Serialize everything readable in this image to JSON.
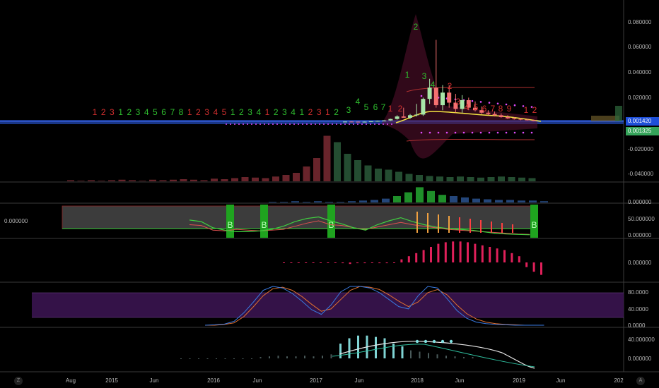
{
  "chart_data": {
    "type": "candlestick",
    "price_axis": {
      "ticks": [
        "0.080000",
        "0.060000",
        "0.040000",
        "0.020000",
        "-0.020000",
        "-0.040000"
      ],
      "last_price": "0.001420",
      "second_price": "0.001325"
    },
    "time_axis": {
      "ticks": [
        "Aug",
        "2015",
        "Jun",
        "2016",
        "Jun",
        "2017",
        "Jun",
        "2018",
        "Jun",
        "2019",
        "Jun",
        "202"
      ]
    },
    "td_sequential": {
      "early": [
        "1",
        "2",
        "3",
        "1",
        "2",
        "3",
        "4",
        "5",
        "6",
        "7",
        "8",
        "1",
        "2",
        "3",
        "4",
        "5",
        "1",
        "2",
        "3",
        "4",
        "1",
        "2",
        "3",
        "4",
        "1",
        "2",
        "3",
        "1",
        "2"
      ],
      "later": [
        {
          "label": "3",
          "color": "green"
        },
        {
          "label": "4",
          "color": "green"
        },
        {
          "label": "5",
          "color": "green"
        },
        {
          "label": "6",
          "color": "green"
        },
        {
          "label": "7",
          "color": "green"
        },
        {
          "label": "1",
          "color": "red"
        },
        {
          "label": "2",
          "color": "red"
        },
        {
          "label": "1",
          "color": "green"
        },
        {
          "label": "2",
          "color": "green"
        },
        {
          "label": "3",
          "color": "green"
        },
        {
          "label": "4",
          "color": "green"
        },
        {
          "label": "2",
          "color": "red"
        },
        {
          "label": "3",
          "color": "red"
        },
        {
          "label": "4",
          "color": "red"
        },
        {
          "label": "5",
          "color": "red"
        },
        {
          "label": "6",
          "color": "red"
        },
        {
          "label": "7",
          "color": "red"
        },
        {
          "label": "8",
          "color": "red"
        },
        {
          "label": "9",
          "color": "red"
        },
        {
          "label": "1",
          "color": "red"
        },
        {
          "label": "2",
          "color": "red"
        }
      ]
    },
    "candles": [
      {
        "o": 0.0008,
        "h": 0.001,
        "l": 0.0006,
        "c": 0.0009
      },
      {
        "o": 0.0009,
        "h": 0.0011,
        "l": 0.0007,
        "c": 0.0008
      },
      {
        "o": 0.0008,
        "h": 0.001,
        "l": 0.0006,
        "c": 0.0007
      },
      {
        "o": 0.0007,
        "h": 0.0009,
        "l": 0.0005,
        "c": 0.0008
      },
      {
        "o": 0.0008,
        "h": 0.0012,
        "l": 0.0007,
        "c": 0.0011
      },
      {
        "o": 0.0011,
        "h": 0.0016,
        "l": 0.0009,
        "c": 0.0014
      },
      {
        "o": 0.0014,
        "h": 0.002,
        "l": 0.0011,
        "c": 0.0018
      },
      {
        "o": 0.0018,
        "h": 0.0032,
        "l": 0.0015,
        "c": 0.003
      },
      {
        "o": 0.003,
        "h": 0.006,
        "l": 0.0024,
        "c": 0.005
      },
      {
        "o": 0.005,
        "h": 0.012,
        "l": 0.004,
        "c": 0.004
      },
      {
        "o": 0.004,
        "h": 0.007,
        "l": 0.003,
        "c": 0.006
      },
      {
        "o": 0.006,
        "h": 0.015,
        "l": 0.005,
        "c": 0.0065
      },
      {
        "o": 0.0065,
        "h": 0.02,
        "l": 0.0055,
        "c": 0.019
      },
      {
        "o": 0.019,
        "h": 0.035,
        "l": 0.015,
        "c": 0.028
      },
      {
        "o": 0.028,
        "h": 0.066,
        "l": 0.012,
        "c": 0.014
      },
      {
        "o": 0.014,
        "h": 0.03,
        "l": 0.01,
        "c": 0.024
      },
      {
        "o": 0.024,
        "h": 0.03,
        "l": 0.012,
        "c": 0.016
      },
      {
        "o": 0.016,
        "h": 0.023,
        "l": 0.008,
        "c": 0.011
      },
      {
        "o": 0.011,
        "h": 0.022,
        "l": 0.008,
        "c": 0.018
      },
      {
        "o": 0.018,
        "h": 0.02,
        "l": 0.01,
        "c": 0.012
      },
      {
        "o": 0.012,
        "h": 0.017,
        "l": 0.009,
        "c": 0.01
      },
      {
        "o": 0.01,
        "h": 0.013,
        "l": 0.007,
        "c": 0.008
      },
      {
        "o": 0.008,
        "h": 0.01,
        "l": 0.006,
        "c": 0.007
      },
      {
        "o": 0.007,
        "h": 0.009,
        "l": 0.005,
        "c": 0.006
      },
      {
        "o": 0.006,
        "h": 0.0075,
        "l": 0.004,
        "c": 0.0045
      },
      {
        "o": 0.0045,
        "h": 0.006,
        "l": 0.003,
        "c": 0.0035
      },
      {
        "o": 0.0035,
        "h": 0.0045,
        "l": 0.0025,
        "c": 0.003
      },
      {
        "o": 0.003,
        "h": 0.0038,
        "l": 0.002,
        "c": 0.0025
      },
      {
        "o": 0.0025,
        "h": 0.003,
        "l": 0.0018,
        "c": 0.002
      },
      {
        "o": 0.002,
        "h": 0.0025,
        "l": 0.0012,
        "c": 0.0015
      }
    ],
    "volume": [
      2,
      1,
      2,
      1,
      2,
      3,
      2,
      1,
      3,
      2,
      3,
      4,
      3,
      2,
      5,
      4,
      6,
      8,
      7,
      6,
      9,
      12,
      16,
      28,
      44,
      86,
      74,
      52,
      40,
      30,
      24,
      22,
      18,
      14,
      12,
      10,
      9,
      8,
      9,
      8,
      7,
      8,
      9,
      8,
      7,
      6
    ],
    "panel_osc": {
      "ticks": [
        "50.000000",
        "0.000000"
      ],
      "left_value": "0.000000",
      "buy_markers": [
        "B",
        "B",
        "B",
        "B"
      ],
      "signal_line": [
        30,
        28,
        16,
        14,
        18,
        16,
        14,
        16,
        18,
        26,
        34,
        40,
        30,
        28,
        22,
        18,
        24,
        30,
        36,
        30,
        26,
        22,
        18,
        16,
        14,
        12,
        10,
        8,
        6,
        5
      ],
      "fast_line": [
        42,
        38,
        22,
        16,
        12,
        12,
        14,
        18,
        26,
        38,
        46,
        50,
        40,
        32,
        22,
        16,
        30,
        40,
        48,
        38,
        30,
        24,
        20,
        18,
        16,
        12,
        8,
        6,
        5,
        4
      ]
    },
    "panel_hist": {
      "ticks": [
        "0.000000"
      ],
      "values": [
        0,
        0,
        0,
        0,
        0,
        0,
        0,
        0,
        -1,
        -2,
        -1,
        -1,
        0,
        -1,
        -1,
        0,
        4,
        8,
        12,
        16,
        20,
        24,
        26,
        27,
        27,
        26,
        24,
        22,
        20,
        18,
        16,
        12,
        8,
        -6,
        -12,
        -16
      ]
    },
    "panel_stoch": {
      "ticks": [
        "80.0000",
        "40.0000",
        "0.0000"
      ],
      "k_line": [
        0,
        1,
        3,
        10,
        32,
        60,
        90,
        100,
        96,
        82,
        62,
        40,
        28,
        52,
        86,
        100,
        100,
        96,
        84,
        66,
        48,
        42,
        76,
        100,
        96,
        68,
        38,
        18,
        8,
        4,
        2,
        1,
        0,
        0,
        0,
        0
      ],
      "d_line": [
        0,
        0,
        2,
        6,
        22,
        48,
        76,
        94,
        98,
        90,
        74,
        54,
        36,
        42,
        66,
        90,
        100,
        98,
        92,
        78,
        62,
        48,
        60,
        84,
        92,
        78,
        52,
        30,
        16,
        8,
        4,
        2,
        1,
        0,
        0,
        0
      ]
    },
    "panel_bottom": {
      "ticks": [
        "40.000000",
        "0.000000"
      ],
      "bars": [
        0,
        0,
        0,
        0,
        0,
        0,
        0,
        0,
        0,
        2,
        3,
        4,
        3,
        3,
        4,
        3,
        4,
        6,
        22,
        30,
        34,
        34,
        32,
        30,
        22,
        18,
        12,
        10,
        8,
        6,
        4,
        3,
        2,
        2
      ]
    }
  },
  "colors": {
    "up": "#26a69a",
    "down": "#ef5350",
    "td_green": "#2fbf2f",
    "td_red": "#d32f2f",
    "last_price_bg": "#1e4fd8",
    "second_price_bg": "#35a45a"
  },
  "corners": {
    "left": "Z",
    "right": "A"
  }
}
